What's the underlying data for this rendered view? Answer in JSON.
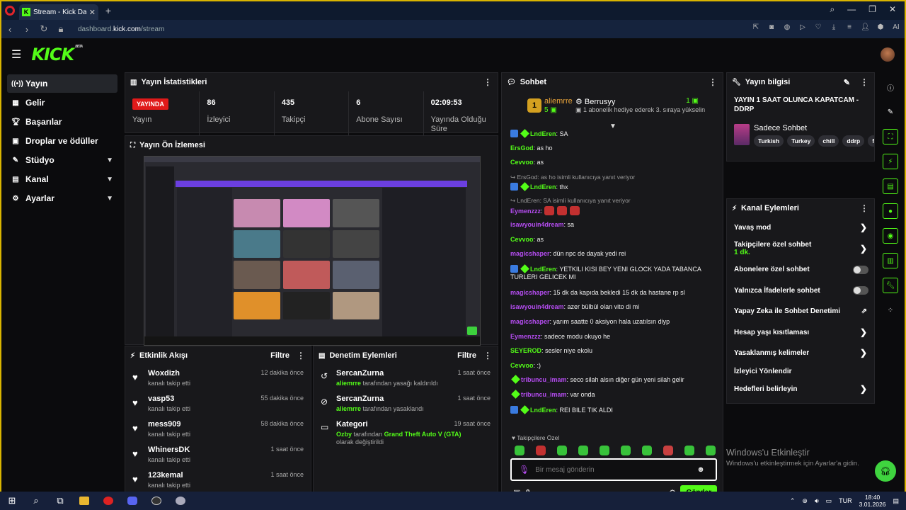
{
  "browser": {
    "tab_title": "Stream - Kick Dashboard",
    "url_domain": "dashboard.",
    "url_host": "kick.com",
    "url_path": "/stream",
    "ai_label": "AI"
  },
  "app": {
    "logo": "KICK",
    "beta": "BETA"
  },
  "sidebar": {
    "items": [
      {
        "label": "Yayın",
        "icon": "broadcast-icon"
      },
      {
        "label": "Gelir",
        "icon": "money-icon"
      },
      {
        "label": "Başarılar",
        "icon": "trophy-icon"
      },
      {
        "label": "Droplar ve ödüller",
        "icon": "gift-icon"
      },
      {
        "label": "Stüdyo",
        "icon": "studio-icon"
      },
      {
        "label": "Kanal",
        "icon": "channel-icon"
      },
      {
        "label": "Ayarlar",
        "icon": "settings-icon"
      }
    ]
  },
  "stats": {
    "title": "Yayın İstatistikleri",
    "live_badge": "YAYINDA",
    "items": [
      {
        "value": "",
        "label": "Yayın"
      },
      {
        "value": "86",
        "label": "İzleyici"
      },
      {
        "value": "435",
        "label": "Takipçi"
      },
      {
        "value": "6",
        "label": "Abone Sayısı"
      },
      {
        "value": "02:09:53",
        "label": "Yayında Olduğu Süre"
      }
    ]
  },
  "preview": {
    "title": "Yayın Ön İzlemesi"
  },
  "activity": {
    "title": "Etkinlik Akışı",
    "filter": "Filtre",
    "items": [
      {
        "name": "Woxdizh",
        "sub": "kanalı takip etti",
        "time": "12 dakika önce"
      },
      {
        "name": "vasp53",
        "sub": "kanalı takip etti",
        "time": "55 dakika önce"
      },
      {
        "name": "mess909",
        "sub": "kanalı takip etti",
        "time": "58 dakika önce"
      },
      {
        "name": "WhinersDK",
        "sub": "kanalı takip etti",
        "time": "1 saat önce"
      },
      {
        "name": "123kemal",
        "sub": "kanalı takip etti",
        "time": "1 saat önce"
      }
    ]
  },
  "moderation": {
    "title": "Denetim Eylemleri",
    "filter": "Filtre",
    "items": [
      {
        "name": "SercanZurna",
        "actor": "aliemrre",
        "text": " tarafından yasağı kaldırıldı",
        "time": "1 saat önce"
      },
      {
        "name": "SercanZurna",
        "actor": "aliemrre",
        "text": " tarafından yasaklandı",
        "time": "1 saat önce"
      },
      {
        "name": "Kategori",
        "actor": "Ozby",
        "text_pre": " tarafından ",
        "game": "Grand Theft Auto V (GTA)",
        "text_post": " olarak değiştirildi",
        "time": "19 saat önce"
      }
    ]
  },
  "chat": {
    "title": "Sohbet",
    "leader": {
      "rank": "1",
      "name": "aliemrre",
      "count": "5"
    },
    "leader2": {
      "name": "Berrusyy",
      "sub": "1 abonelik hediye ederek 3. sıraya yükselin",
      "count": "1"
    },
    "messages": [
      {
        "user": "LndEren",
        "text": ": SA",
        "color": "#53fc18",
        "badges": true,
        "type": "msg"
      },
      {
        "user": "ErsGod",
        "text": ": as ho",
        "color": "#53fc18",
        "badges": false,
        "type": "msg"
      },
      {
        "user": "Cevvoo",
        "text": ": as",
        "color": "#53fc18",
        "badges": false,
        "type": "msg"
      },
      {
        "user": "",
        "text": "ErsGod: as ho isimli kullanıcıya yanıt veriyor",
        "type": "reply"
      },
      {
        "user": "LndEren",
        "text": ": thx",
        "color": "#53fc18",
        "badges": true,
        "type": "msg"
      },
      {
        "user": "",
        "text": "LndEren: SA isimli kullanıcıya yanıt veriyor",
        "type": "reply"
      },
      {
        "user": "Eymenzzz",
        "text": ":",
        "color": "#b44cf0",
        "badges": false,
        "type": "emotes"
      },
      {
        "user": "isawyouin4dream",
        "text": ": sa",
        "color": "#b44cf0",
        "badges": false,
        "type": "msg"
      },
      {
        "user": "Cevvoo",
        "text": ": as",
        "color": "#53fc18",
        "badges": false,
        "type": "msg"
      },
      {
        "user": "magicshaper",
        "text": ": dün npc de dayak yedi rei",
        "color": "#b44cf0",
        "badges": false,
        "type": "msg"
      },
      {
        "user": "LndEren",
        "text": ": YETKILI KISI BEY YENI GLOCK YADA TABANCA TURLERI GELICEK MI",
        "color": "#53fc18",
        "badges": true,
        "type": "msg2"
      },
      {
        "user": "magicshaper",
        "text": ": 15 dk da kapıda bekledi 15 dk da hastane rp sl",
        "color": "#b44cf0",
        "badges": false,
        "type": "msg"
      },
      {
        "user": "isawyouin4dream",
        "text": ": azer bülbül olan vito di mi",
        "color": "#b44cf0",
        "badges": false,
        "type": "msg"
      },
      {
        "user": "magicshaper",
        "text": ": yarım saatte 0 aksiyon hala uzatılsın diyp",
        "color": "#b44cf0",
        "badges": false,
        "type": "msg"
      },
      {
        "user": "Eymenzzz",
        "text": ": sadece modu okuyo he",
        "color": "#b44cf0",
        "badges": false,
        "type": "msg"
      },
      {
        "user": "SEYEROD",
        "text": ": sesler niye ekolu",
        "color": "#53fc18",
        "badges": false,
        "type": "msg"
      },
      {
        "user": "Cevvoo",
        "text": ": :)",
        "color": "#53fc18",
        "badges": false,
        "type": "msg"
      },
      {
        "user": "tribuncu_imam",
        "text": ": seco silah alsın diğer gün yeni silah gelir",
        "color": "#b44cf0",
        "badges": "one",
        "type": "msg"
      },
      {
        "user": "tribuncu_imam",
        "text": ": var onda",
        "color": "#b44cf0",
        "badges": "one",
        "type": "msg"
      },
      {
        "user": "LndEren",
        "text": ": REI BILE TIK ALDI",
        "color": "#53fc18",
        "badges": true,
        "type": "msg"
      }
    ],
    "pinned_label": "Takipçilere Özel",
    "input_placeholder": "Bir mesaj gönderin",
    "points": "0",
    "send_label": "Gönder"
  },
  "info": {
    "title": "Yayın bilgisi",
    "stream_title": "YAYIN 1 SAAT OLUNCA KAPATCAM - DDRP",
    "category": "Sadece Sohbet",
    "tags": [
      "Turkish",
      "Turkey",
      "chill",
      "ddrp",
      "f"
    ]
  },
  "actions": {
    "title": "Kanal Eylemleri",
    "items": [
      {
        "label": "Yavaş mod",
        "kind": "chev"
      },
      {
        "label": "Takipçilere özel sohbet",
        "sub": "1 dk.",
        "kind": "chev"
      },
      {
        "label": "Abonelere özel sohbet",
        "kind": "toggle"
      },
      {
        "label": "Yalnızca İfadelerle sohbet",
        "kind": "toggle"
      },
      {
        "label": "Yapay Zeka ile Sohbet Denetimi",
        "kind": "ext"
      },
      {
        "label": "Hesap yaşı kısıtlaması",
        "kind": "chev"
      },
      {
        "label": "Yasaklanmış kelimeler",
        "kind": "chev"
      },
      {
        "label": "İzleyici Yönlendir",
        "kind": "none"
      },
      {
        "label": "Hedefleri belirleyin",
        "kind": "chev"
      }
    ]
  },
  "watermark": {
    "line1": "Windows'u Etkinleştir",
    "line2": "Windows'u etkinleştirmek için Ayarlar'a gidin."
  },
  "taskbar": {
    "lang": "TUR",
    "time": "18:40",
    "date": "3.01.2026"
  },
  "colors": {
    "accent": "#53fc18",
    "live": "#e01a1a",
    "purple_user": "#b44cf0"
  }
}
